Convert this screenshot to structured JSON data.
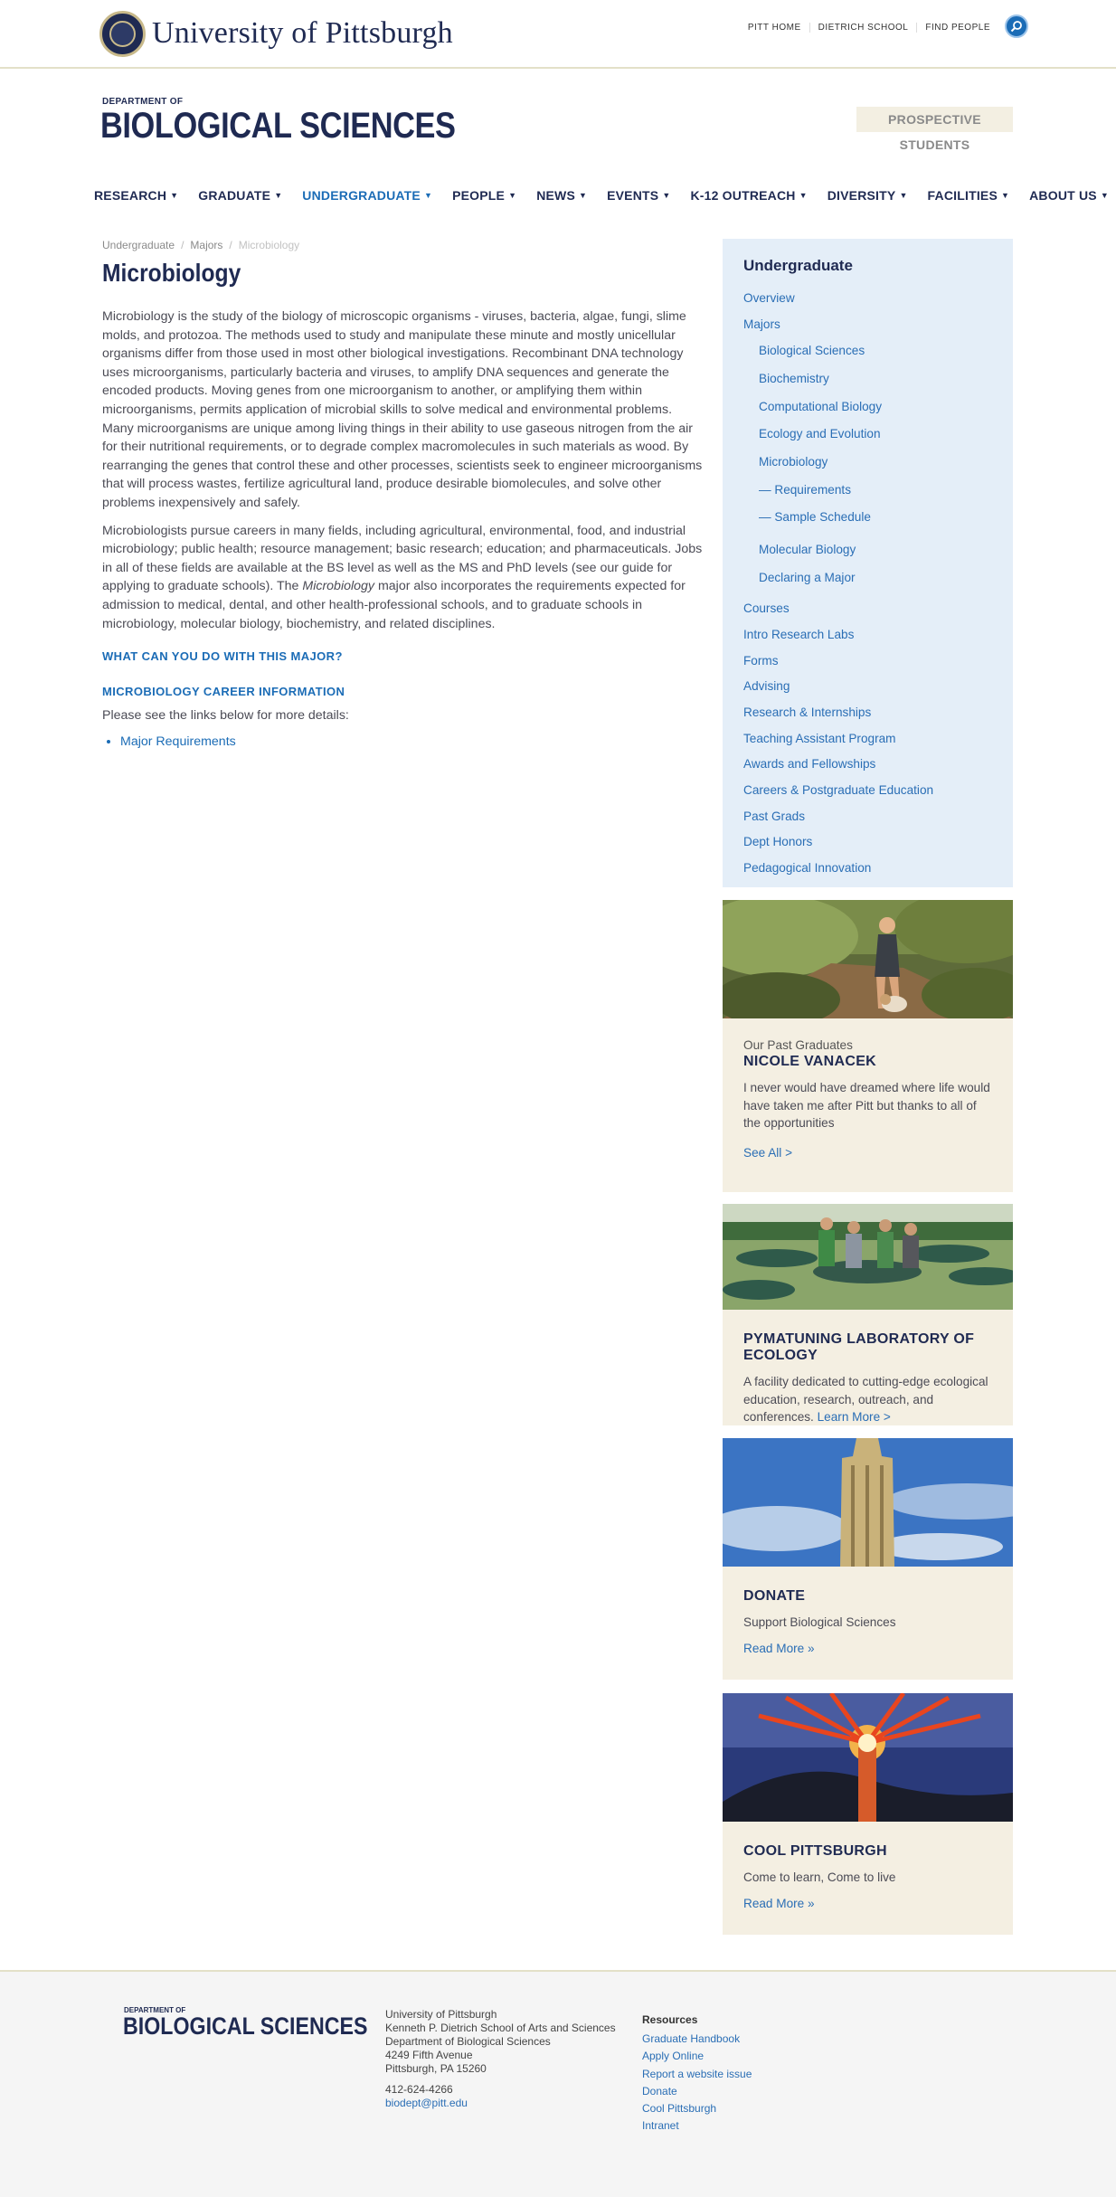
{
  "header": {
    "university_name": "University of Pittsburgh",
    "utility_links": [
      "PITT HOME",
      "DIETRICH SCHOOL",
      "FIND PEOPLE"
    ],
    "dept_small": "DEPARTMENT OF",
    "dept_name": "BIOLOGICAL SCIENCES",
    "prospective_button": "PROSPECTIVE STUDENTS"
  },
  "nav": {
    "items": [
      "RESEARCH",
      "GRADUATE",
      "UNDERGRADUATE",
      "PEOPLE",
      "NEWS",
      "EVENTS",
      "K-12 OUTREACH",
      "DIVERSITY",
      "FACILITIES",
      "ABOUT US"
    ],
    "active": "UNDERGRADUATE"
  },
  "breadcrumb": {
    "items": [
      "Undergraduate",
      "Majors"
    ],
    "current": "Microbiology",
    "separator": "/"
  },
  "page": {
    "title": "Microbiology",
    "paragraph1": "Microbiology is the study of the biology of microscopic organisms - viruses, bacteria, algae, fungi, slime molds, and protozoa. The methods used to study and manipulate these minute and mostly unicellular organisms differ from those used in most other biological investigations. Recombinant DNA technology uses microorganisms, particularly bacteria and viruses, to amplify DNA sequences and generate the encoded products. Moving genes from one microorganism to another, or amplifying them within microorganisms, permits application of microbial skills to solve medical and environmental problems. Many microorganisms are unique among living things in their ability to use gaseous nitrogen from the air for their nutritional requirements, or to degrade complex macromolecules in such materials as wood. By rearranging the genes that control these and other processes, scientists seek to engineer microorganisms that will process wastes, fertilize agricultural land, produce desirable biomolecules, and solve other problems inexpensively and safely.",
    "paragraph2_before": "Microbiologists pursue careers in many fields, including agricultural, environmental, food, and industrial microbiology; public health; resource management; basic research; education; and pharmaceuticals. Jobs in all of these fields are available at the BS level as well as the MS and PhD levels (see our guide for applying to graduate schools). The ",
    "paragraph2_italic": "Microbiology",
    "paragraph2_after": " major also incorporates the requirements expected for admission to medical, dental, and other health-professional schools, and to graduate schools in microbiology, molecular biology, biochemistry, and related disciplines.",
    "heading1": "WHAT CAN YOU DO WITH THIS MAJOR?",
    "heading2": "MICROBIOLOGY CAREER INFORMATION",
    "links_intro": "Please see the links below for more details:",
    "links": [
      "Major Requirements"
    ]
  },
  "sidebar": {
    "title": "Undergraduate",
    "top_items": [
      "Overview",
      "Majors"
    ],
    "majors": [
      "Biological Sciences",
      "Biochemistry",
      "Computational Biology",
      "Ecology and Evolution",
      "Microbiology"
    ],
    "micro_sub": [
      "— Requirements",
      "— Sample Schedule"
    ],
    "majors_more": [
      "Molecular Biology",
      "Declaring a Major"
    ],
    "bottom_items": [
      "Courses",
      "Intro Research Labs",
      "Forms",
      "Advising",
      "Research & Internships",
      "Teaching Assistant Program",
      "Awards and Fellowships",
      "Careers & Postgraduate Education",
      "Past Grads",
      "Dept Honors",
      "Pedagogical Innovation"
    ]
  },
  "cards": {
    "graduates": {
      "kicker": "Our Past Graduates",
      "title": "NICOLE VANACEK",
      "text": "I never would have dreamed where life would have taken me after Pitt but thanks to all of the opportunities",
      "link": "See All >"
    },
    "pymatuning": {
      "title": "PYMATUNING LABORATORY OF ECOLOGY",
      "text": "A facility dedicated to cutting-edge ecological education, research, outreach, and conferences.",
      "link": "Learn More >"
    },
    "donate": {
      "title": "DONATE",
      "text": "Support Biological Sciences",
      "link": "Read More »"
    },
    "cool": {
      "title": "COOL PITTSBURGH",
      "text": "Come to learn, Come to live",
      "link": "Read More »"
    }
  },
  "footer": {
    "dept_small": "DEPARTMENT OF",
    "dept_name": "BIOLOGICAL SCIENCES",
    "address": [
      "University of Pittsburgh",
      "Kenneth P. Dietrich School of Arts and Sciences",
      "Department of Biological Sciences",
      "4249 Fifth Avenue",
      "Pittsburgh, PA 15260"
    ],
    "phone": "412-624-4266",
    "email": "biodept@pitt.edu",
    "resources_title": "Resources",
    "resources": [
      "Graduate Handbook",
      "Apply Online",
      "Report a website issue",
      "Donate",
      "Cool Pittsburgh",
      "Intranet"
    ]
  },
  "icons": {
    "search": "search-icon",
    "chevron": "chevron-down-icon",
    "seal": "university-seal-icon"
  },
  "colors": {
    "navy": "#1f2a52",
    "link_blue": "#2a6eb5",
    "sidebar_bg": "#e4eef8",
    "card_bg": "#f4efe2"
  }
}
